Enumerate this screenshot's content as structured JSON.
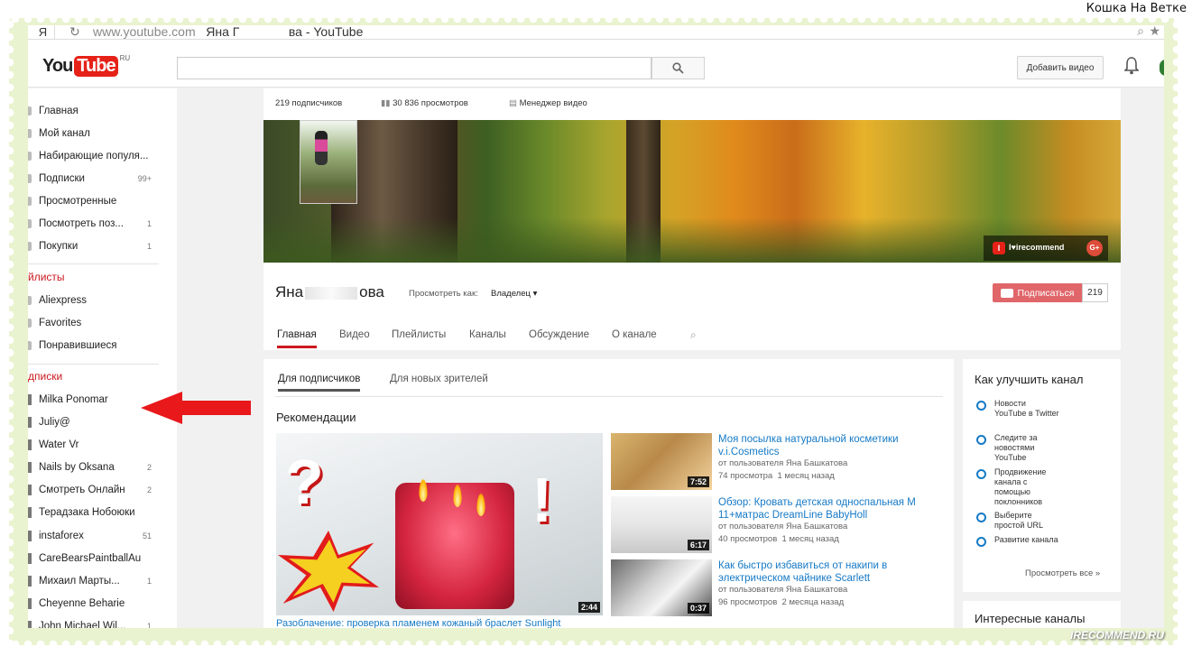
{
  "top_caption": "Кошка На Ветке",
  "browser": {
    "yandex_label": "Я",
    "url": "www.youtube.com",
    "page_title_part1": "Яна Г",
    "page_title_part2": "ва - YouTube"
  },
  "header": {
    "logo_you": "You",
    "logo_tube": "Tube",
    "logo_region": "RU",
    "upload_label": "Добавить видео"
  },
  "sidebar": {
    "items": [
      {
        "label": "Главная",
        "count": ""
      },
      {
        "label": "Мой канал",
        "count": ""
      },
      {
        "label": "Набирающие популя...",
        "count": ""
      },
      {
        "label": "Подписки",
        "count": "99+"
      },
      {
        "label": "Просмотренные",
        "count": ""
      },
      {
        "label": "Посмотреть поз...",
        "count": "1"
      },
      {
        "label": "Покупки",
        "count": "1"
      }
    ],
    "playlists_header": "йлисты",
    "playlists": [
      {
        "label": "Aliexpress"
      },
      {
        "label": "Favorites"
      },
      {
        "label": "Понравившиеся"
      }
    ],
    "subs_header": "дписки",
    "subscriptions": [
      {
        "label": "Milka Ponomar",
        "count": ""
      },
      {
        "label": "Juliy@",
        "count": ""
      },
      {
        "label": "Water Vr",
        "count": ""
      },
      {
        "label": "Nails by Oksana",
        "count": "2"
      },
      {
        "label": "Смотреть Онлайн",
        "count": "2"
      },
      {
        "label": "Терадзака Нобоюки",
        "count": ""
      },
      {
        "label": "instaforex",
        "count": "51"
      },
      {
        "label": "CareBearsPaintballAu",
        "count": ""
      },
      {
        "label": "Михаил Марты...",
        "count": "1"
      },
      {
        "label": "Cheyenne Beharie",
        "count": ""
      },
      {
        "label": "John Michael Wil...",
        "count": "1"
      }
    ]
  },
  "channel": {
    "subscribers_stat": "219 подписчиков",
    "views_stat": "30 836 просмотров",
    "video_manager": "Менеджер видео",
    "irecommend_label": "I♥irecommend",
    "gplus_label": "G+",
    "name_part1": "Яна",
    "name_part2": "ова",
    "view_as_label": "Просмотреть как:",
    "view_as_value": "Владелец ▾",
    "subscribe_label": "Подписаться",
    "subscribe_count": "219",
    "tabs": [
      {
        "label": "Главная"
      },
      {
        "label": "Видео"
      },
      {
        "label": "Плейлисты"
      },
      {
        "label": "Каналы"
      },
      {
        "label": "Обсуждение"
      },
      {
        "label": "О канале"
      }
    ]
  },
  "content": {
    "sub_tabs": [
      {
        "label": "Для подписчиков"
      },
      {
        "label": "Для новых зрителей"
      }
    ],
    "section_title": "Рекомендации",
    "featured": {
      "duration": "2:44",
      "caption": "Разоблачение: проверка пламенем кожаный браслет Sunlight"
    },
    "videos": [
      {
        "title": "Моя посылка натуральной косметики v.i.Cosmetics",
        "by": "от пользователя Яна Башкатова",
        "views": "74 просмотра",
        "age": "1 месяц назад",
        "duration": "7:52"
      },
      {
        "title": "Обзор: Кровать детская односпальная М 11+матрас DreamLine BabyHoll",
        "by": "от пользователя Яна Башкатова",
        "views": "40 просмотров",
        "age": "1 месяц назад",
        "duration": "6:17"
      },
      {
        "title": "Как быстро избавиться от накипи в электрическом чайнике Scarlett",
        "by": "от пользователя Яна Башкатова",
        "views": "96 просмотров",
        "age": "2 месяца назад",
        "duration": "0:37"
      }
    ]
  },
  "right_panel": {
    "title": "Как улучшить канал",
    "items": [
      {
        "text": "Новости YouTube в Twitter"
      },
      {
        "text": "Следите за новостями YouTube"
      },
      {
        "text": "Продвижение канала с помощью поклонников"
      },
      {
        "text": "Выберите простой URL"
      },
      {
        "text": "Развитие канала"
      }
    ],
    "more_label": "Просмотреть все »",
    "second_title": "Интересные каналы"
  },
  "watermark": "IRECOMMEND.RU",
  "colors": {
    "accent_red": "#cc181e",
    "link_blue": "#167ac6",
    "frame_green": "#e9f3cf"
  }
}
